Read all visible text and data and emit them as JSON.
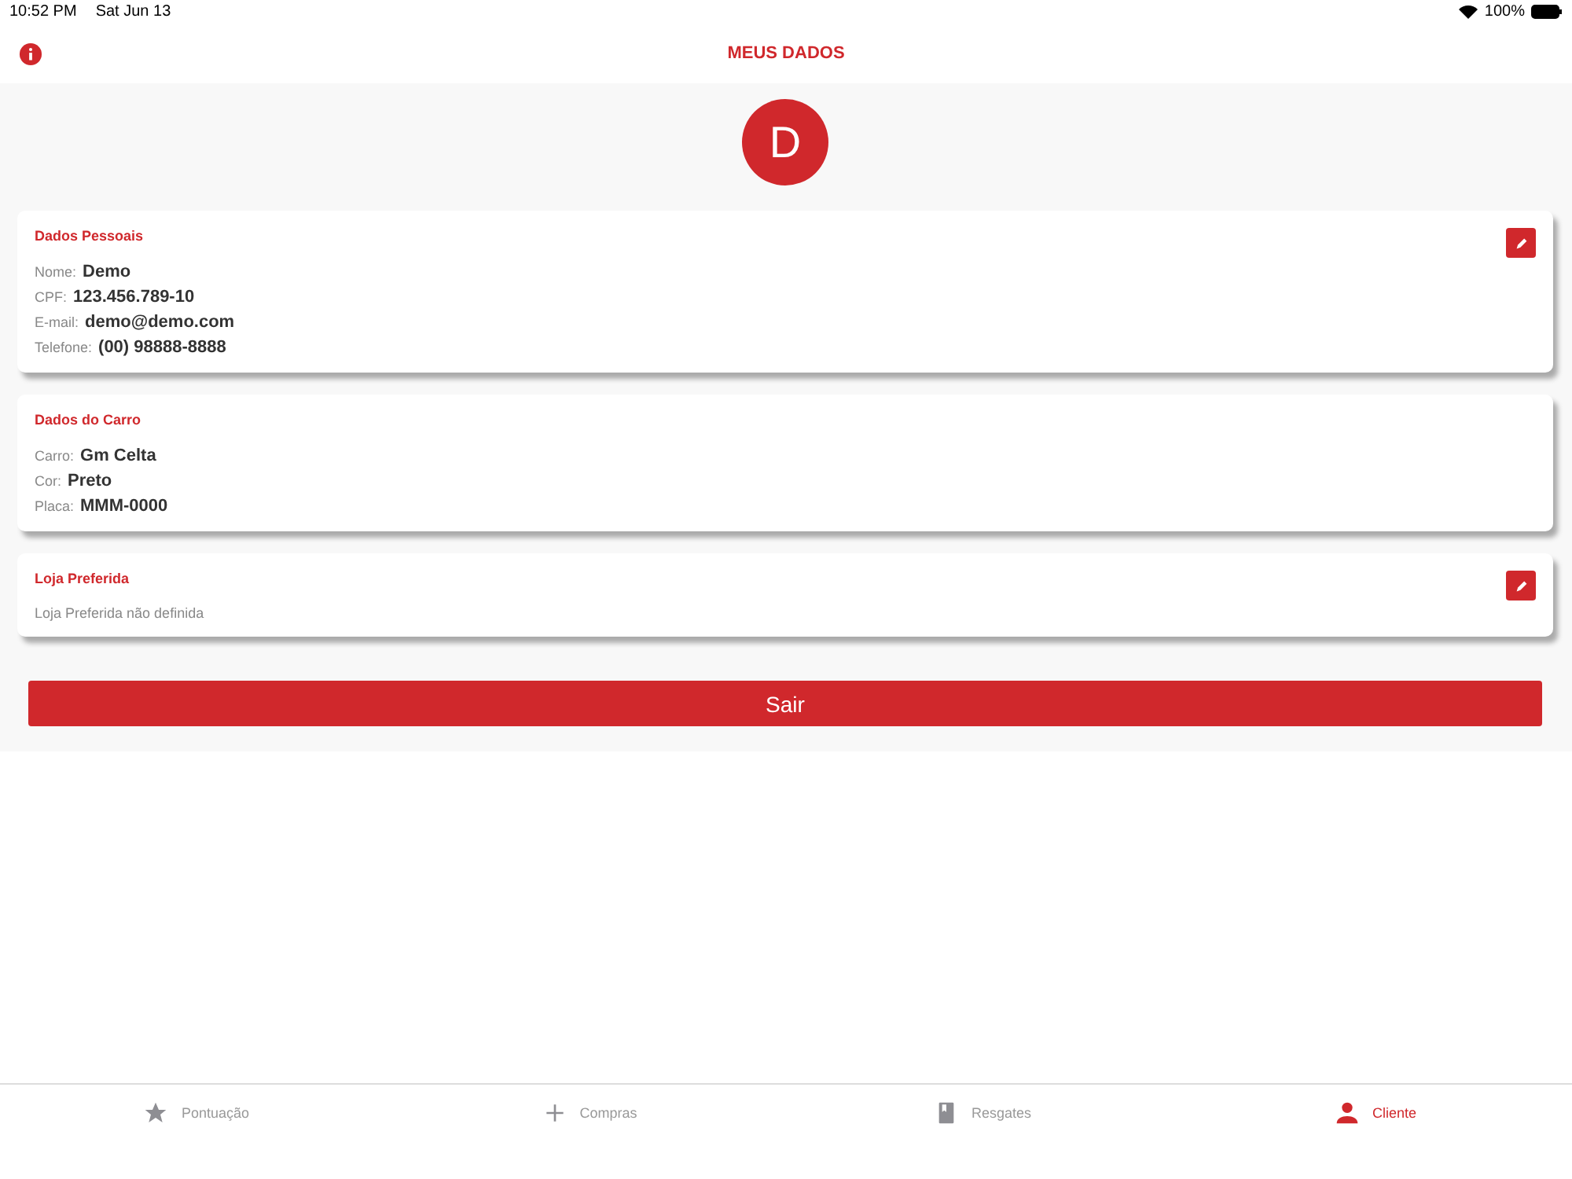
{
  "status_bar": {
    "time": "10:52 PM",
    "date": "Sat Jun 13",
    "battery": "100%"
  },
  "header": {
    "title": "MEUS DADOS"
  },
  "avatar": {
    "initial": "D"
  },
  "cards": [
    {
      "title": "Dados Pessoais",
      "editable": true,
      "fields": [
        {
          "label": "Nome:",
          "value": "Demo"
        },
        {
          "label": "CPF:",
          "value": "123.456.789-10"
        },
        {
          "label": "E-mail:",
          "value": "demo@demo.com"
        },
        {
          "label": "Telefone:",
          "value": "(00) 98888-8888"
        }
      ]
    },
    {
      "title": "Dados do Carro",
      "editable": false,
      "fields": [
        {
          "label": "Carro:",
          "value": "Gm Celta"
        },
        {
          "label": "Cor:",
          "value": "Preto"
        },
        {
          "label": "Placa:",
          "value": "MMM-0000"
        }
      ]
    },
    {
      "title": "Loja Preferida",
      "editable": true,
      "note": "Loja Preferida não definida"
    }
  ],
  "logout_button": "Sair",
  "tabs": [
    {
      "kind": "star",
      "label": "Pontuação",
      "selected": false
    },
    {
      "kind": "plus",
      "label": "Compras",
      "selected": false
    },
    {
      "kind": "book",
      "label": "Resgates",
      "selected": false
    },
    {
      "kind": "person",
      "label": "Cliente",
      "selected": true
    }
  ]
}
